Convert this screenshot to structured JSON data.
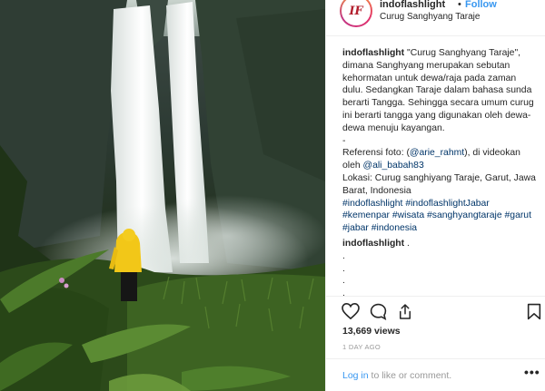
{
  "post": {
    "avatar_initials": "IF",
    "username": "indoflashlight",
    "separator": "•",
    "follow_label": "Follow",
    "location": "Curug Sanghyang Taraje"
  },
  "caption": {
    "author": "indoflashlight",
    "text_1": "\"Curug Sanghyang Taraje\", dimana Sanghyang merupakan sebutan kehormatan untuk dewa/raja pada zaman dulu. Sedangkan Taraje dalam bahasa sunda berarti Tangga. Sehingga secara umum curug ini berarti tangga yang digunakan oleh dewa-dewa menuju kayangan.",
    "dash": "-",
    "ref_prefix": "Referensi foto: (",
    "ref_mention_1": "@arie_rahmt",
    "ref_middle": "), di videokan oleh ",
    "ref_mention_2": "@ali_babah83",
    "location_line": "Lokasi: Curug sanghiyang Taraje, Garut, Jawa Barat, Indonesia",
    "hashtags": [
      "#indoflashlight",
      "#indoflashlightJabar",
      "#kemenpar",
      "#wisata",
      "#sanghyangtaraje",
      "#garut",
      "#jabar",
      "#indonesia"
    ]
  },
  "comment": {
    "author": "indoflashlight",
    "text": ".",
    "extra_dots": [
      ".",
      ".",
      ".",
      "."
    ]
  },
  "actions": {
    "like_icon": "heart-icon",
    "comment_icon": "comment-bubble-icon",
    "share_icon": "share-icon",
    "save_icon": "bookmark-icon"
  },
  "stats": {
    "likes": "13,669 views",
    "time": "1 DAY AGO"
  },
  "footer": {
    "login_link": "Log in",
    "login_text": " to like or comment.",
    "more": "•••"
  },
  "colors": {
    "link_blue": "#3897f0",
    "hashtag": "#003569",
    "text": "#262626",
    "muted": "#999999"
  }
}
